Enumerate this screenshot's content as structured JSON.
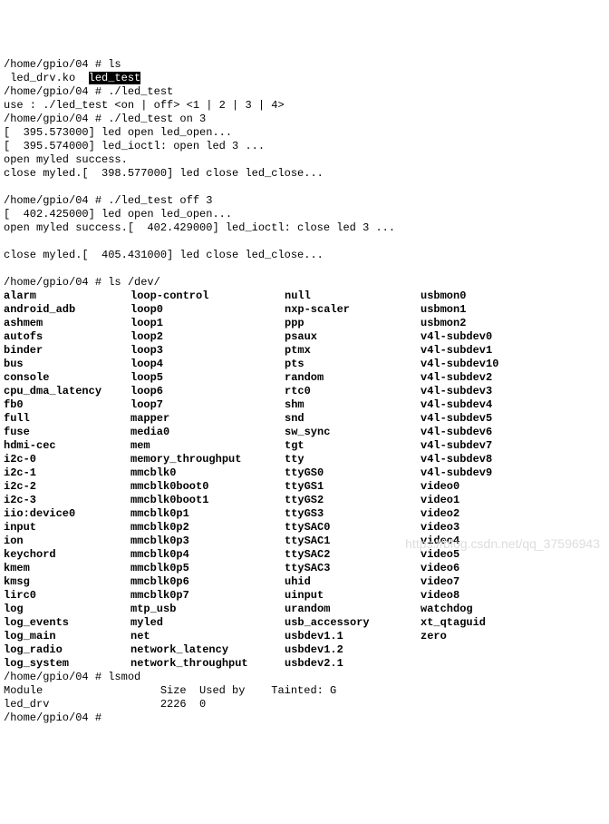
{
  "lines": {
    "p1": "/home/gpio/04 # ls",
    "ls1a": " led_drv.ko  ",
    "ls1b": "led_test",
    "p2": "/home/gpio/04 # ./led_test",
    "usage": "use : ./led_test <on | off> <1 | 2 | 3 | 4>",
    "p3": "/home/gpio/04 # ./led_test on 3",
    "k1": "[  395.573000] led open led_open...",
    "k2": "[  395.574000] led_ioctl: open led 3 ...",
    "ok1": "open myled success.",
    "cl1": "close myled.[  398.577000] led close led_close...",
    "blank1": "",
    "p4": "/home/gpio/04 # ./led_test off 3",
    "k3": "[  402.425000] led open led_open...",
    "ok2": "open myled success.[  402.429000] led_ioctl: close led 3 ...",
    "blank2": "",
    "cl2": "close myled.[  405.431000] led close led_close...",
    "blank3": "",
    "p5": "/home/gpio/04 # ls /dev/"
  },
  "devtable": [
    [
      "alarm",
      "loop-control",
      "null",
      "usbmon0"
    ],
    [
      "android_adb",
      "loop0",
      "nxp-scaler",
      "usbmon1"
    ],
    [
      "ashmem",
      "loop1",
      "ppp",
      "usbmon2"
    ],
    [
      "autofs",
      "loop2",
      "psaux",
      "v4l-subdev0"
    ],
    [
      "binder",
      "loop3",
      "ptmx",
      "v4l-subdev1"
    ],
    [
      "bus",
      "loop4",
      "pts",
      "v4l-subdev10"
    ],
    [
      "console",
      "loop5",
      "random",
      "v4l-subdev2"
    ],
    [
      "cpu_dma_latency",
      "loop6",
      "rtc0",
      "v4l-subdev3"
    ],
    [
      "fb0",
      "loop7",
      "shm",
      "v4l-subdev4"
    ],
    [
      "full",
      "mapper",
      "snd",
      "v4l-subdev5"
    ],
    [
      "fuse",
      "media0",
      "sw_sync",
      "v4l-subdev6"
    ],
    [
      "hdmi-cec",
      "mem",
      "tgt",
      "v4l-subdev7"
    ],
    [
      "i2c-0",
      "memory_throughput",
      "tty",
      "v4l-subdev8"
    ],
    [
      "i2c-1",
      "mmcblk0",
      "ttyGS0",
      "v4l-subdev9"
    ],
    [
      "i2c-2",
      "mmcblk0boot0",
      "ttyGS1",
      "video0"
    ],
    [
      "i2c-3",
      "mmcblk0boot1",
      "ttyGS2",
      "video1"
    ],
    [
      "iio:device0",
      "mmcblk0p1",
      "ttyGS3",
      "video2"
    ],
    [
      "input",
      "mmcblk0p2",
      "ttySAC0",
      "video3"
    ],
    [
      "ion",
      "mmcblk0p3",
      "ttySAC1",
      "video4"
    ],
    [
      "keychord",
      "mmcblk0p4",
      "ttySAC2",
      "video5"
    ],
    [
      "kmem",
      "mmcblk0p5",
      "ttySAC3",
      "video6"
    ],
    [
      "kmsg",
      "mmcblk0p6",
      "uhid",
      "video7"
    ],
    [
      "lirc0",
      "mmcblk0p7",
      "uinput",
      "video8"
    ],
    [
      "log",
      "mtp_usb",
      "urandom",
      "watchdog"
    ],
    [
      "log_events",
      "myled",
      "usb_accessory",
      "xt_qtaguid"
    ],
    [
      "log_main",
      "net",
      "usbdev1.1",
      "zero"
    ],
    [
      "log_radio",
      "network_latency",
      "usbdev1.2",
      ""
    ],
    [
      "log_system",
      "network_throughput",
      "usbdev2.1",
      ""
    ]
  ],
  "tail": {
    "p6": "/home/gpio/04 # lsmod",
    "hdr": "Module                  Size  Used by    Tainted: G",
    "row": "led_drv                 2226  0",
    "p7": "/home/gpio/04 # "
  },
  "watermark": "https://blog.csdn.net/qq_37596943"
}
